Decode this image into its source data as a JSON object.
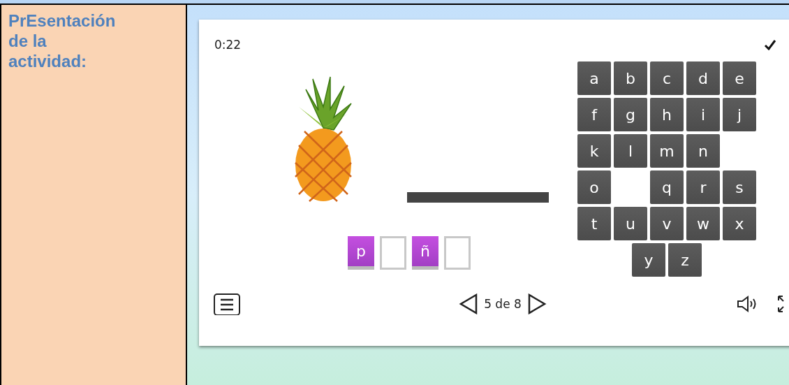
{
  "sidebar": {
    "title": "PrEsentación de la actividad:"
  },
  "activity": {
    "timer": "0:22",
    "answer_slots": [
      {
        "letter": "p",
        "filled": true
      },
      {
        "filled": false
      },
      {
        "letter": "ñ",
        "filled": true
      },
      {
        "filled": false
      }
    ],
    "keyboard": {
      "rows": [
        [
          {
            "kind": "key",
            "label": "a"
          },
          {
            "kind": "key",
            "label": "b"
          },
          {
            "kind": "key",
            "label": "c"
          },
          {
            "kind": "key",
            "label": "d"
          },
          {
            "kind": "key",
            "label": "e"
          }
        ],
        [
          {
            "kind": "key",
            "label": "f"
          },
          {
            "kind": "key",
            "label": "g"
          },
          {
            "kind": "key",
            "label": "h"
          },
          {
            "kind": "key",
            "label": "i"
          },
          {
            "kind": "key",
            "label": "j"
          }
        ],
        [
          {
            "kind": "key",
            "label": "k"
          },
          {
            "kind": "key",
            "label": "l"
          },
          {
            "kind": "key",
            "label": "m"
          },
          {
            "kind": "key",
            "label": "n"
          },
          {
            "kind": "gap"
          }
        ],
        [
          {
            "kind": "key",
            "label": "o"
          },
          {
            "kind": "gap"
          },
          {
            "kind": "key",
            "label": "q"
          },
          {
            "kind": "key",
            "label": "r"
          },
          {
            "kind": "key",
            "label": "s"
          }
        ],
        [
          {
            "kind": "key",
            "label": "t"
          },
          {
            "kind": "key",
            "label": "u"
          },
          {
            "kind": "key",
            "label": "v"
          },
          {
            "kind": "key",
            "label": "w"
          },
          {
            "kind": "key",
            "label": "x"
          }
        ],
        [
          {
            "kind": "key",
            "label": "y"
          },
          {
            "kind": "key",
            "label": "z"
          }
        ]
      ]
    },
    "footer": {
      "page": "5 de 8"
    }
  }
}
